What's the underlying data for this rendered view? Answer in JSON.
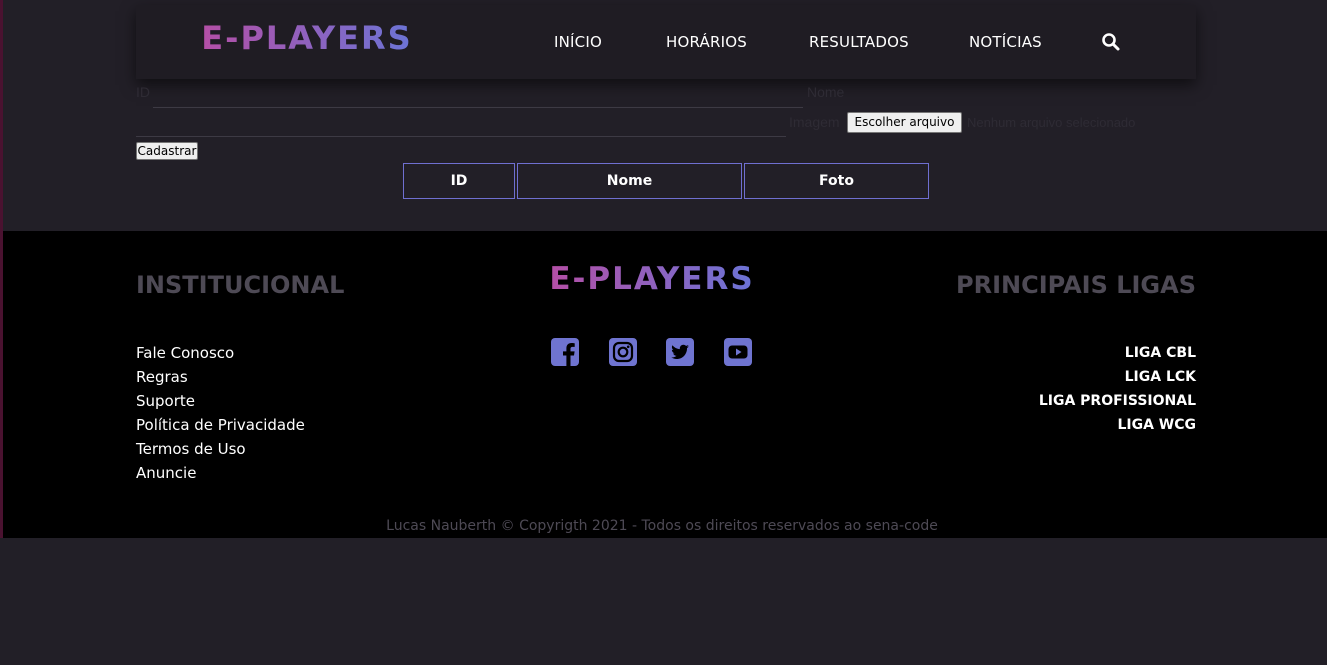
{
  "brand": {
    "logo_text": "E-PLAYERS",
    "gradient_start": "#b44fa6",
    "gradient_end": "#6b74d6"
  },
  "nav": {
    "items": [
      {
        "label": "INÍCIO"
      },
      {
        "label": "HORÁRIOS"
      },
      {
        "label": "RESULTADOS"
      },
      {
        "label": "NOTÍCIAS"
      }
    ],
    "search_icon": "search-icon"
  },
  "form": {
    "id_label": "ID",
    "id_value": "",
    "nome_label": "Nome",
    "nome_value": "",
    "image_label": "Imagem",
    "file_button_label": "Escolher arquivo",
    "file_status": "Nenhum arquivo selecionado",
    "submit_label": "Cadastrar"
  },
  "table": {
    "columns": [
      "ID",
      "Nome",
      "Foto"
    ],
    "border_color": "#6f6fd0"
  },
  "footer": {
    "institutional_heading": "INSTITUCIONAL",
    "institutional_links": [
      "Fale Conosco",
      "Regras",
      "Suporte",
      "Política de Privacidade",
      "Termos de Uso",
      "Anuncie"
    ],
    "leagues_heading": "PRINCIPAIS LIGAS",
    "leagues": [
      "LIGA CBL",
      "LIGA LCK",
      "LIGA PROFISSIONAL",
      "LIGA WCG"
    ],
    "social_icons": [
      "facebook-icon",
      "instagram-icon",
      "twitter-icon",
      "youtube-icon"
    ],
    "social_color": "#6f74d0",
    "copyright": "Lucas Nauberth © Copyrigth 2021 - Todos os direitos reservados ao sena-code"
  },
  "colors": {
    "page_background": "#221f27",
    "footer_background": "#000000",
    "heading_muted": "#4e4a55"
  }
}
